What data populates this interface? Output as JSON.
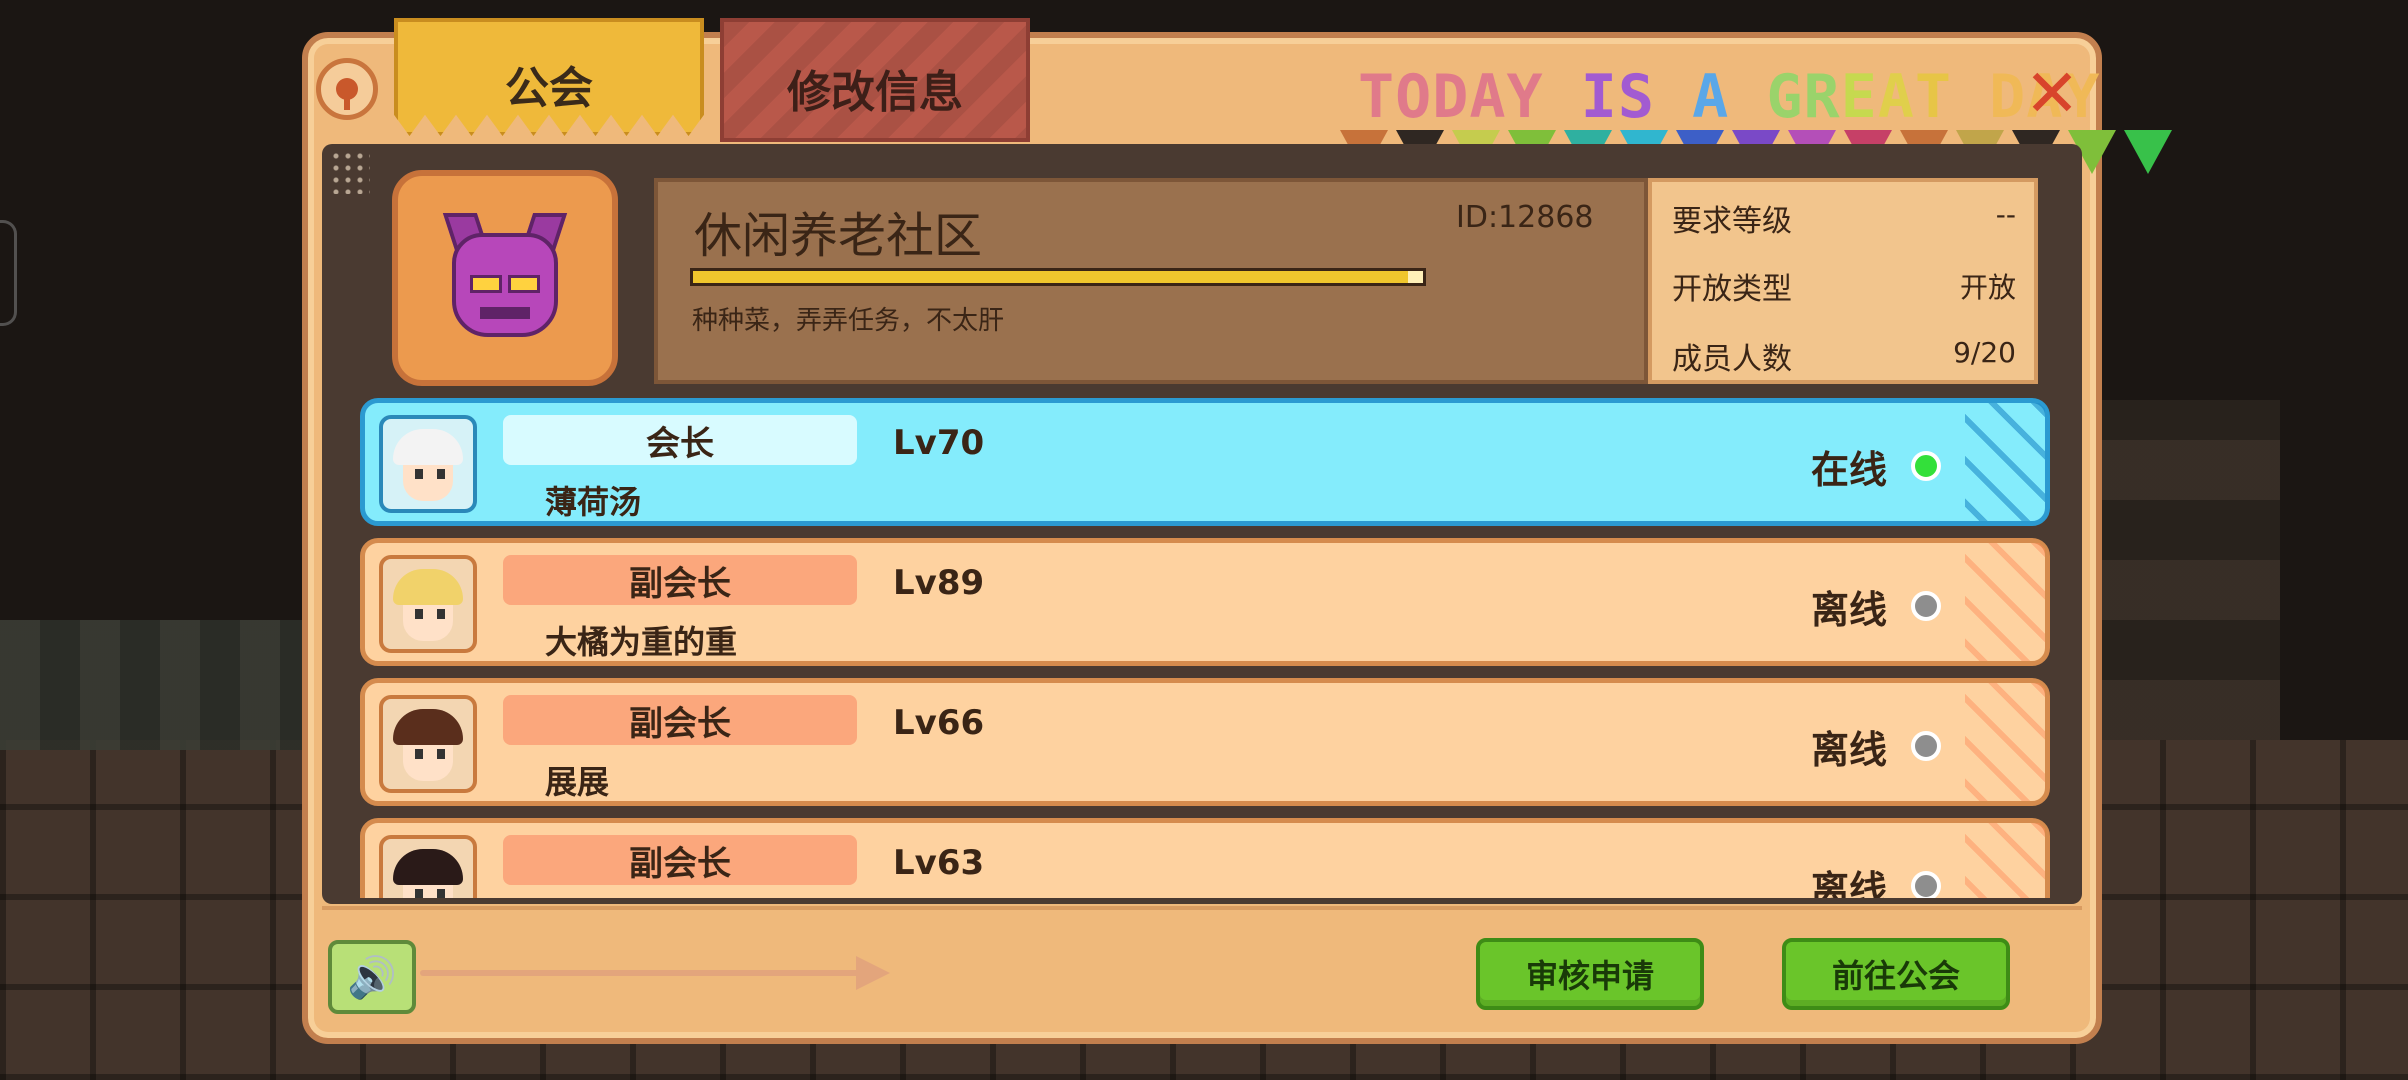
{
  "tabs": [
    {
      "label": "公会",
      "active": true
    },
    {
      "label": "修改信息",
      "active": false
    }
  ],
  "banner": {
    "letters": [
      {
        "c": "T",
        "color": "#e07a8a"
      },
      {
        "c": "O",
        "color": "#e07a8a"
      },
      {
        "c": "D",
        "color": "#e07a8a"
      },
      {
        "c": "A",
        "color": "#e07a8a"
      },
      {
        "c": "Y",
        "color": "#e07a8a"
      },
      {
        "c": " ",
        "color": "#000"
      },
      {
        "c": "I",
        "color": "#a25bd1"
      },
      {
        "c": "S",
        "color": "#a25bd1"
      },
      {
        "c": " ",
        "color": "#000"
      },
      {
        "c": "A",
        "color": "#5aa7e8"
      },
      {
        "c": " ",
        "color": "#000"
      },
      {
        "c": "G",
        "color": "#9ad36b"
      },
      {
        "c": "R",
        "color": "#9ad36b"
      },
      {
        "c": "E",
        "color": "#c6d94f"
      },
      {
        "c": "A",
        "color": "#e0cf4b"
      },
      {
        "c": "T",
        "color": "#e7c546"
      },
      {
        "c": " ",
        "color": "#000"
      },
      {
        "c": "D",
        "color": "#f0b957"
      },
      {
        "c": "A",
        "color": "#f0b957"
      },
      {
        "c": "Y",
        "color": "#f0b957"
      }
    ]
  },
  "flags": [
    "#c7723a",
    "#2f2722",
    "#c5cc4e",
    "#7fbf3a",
    "#2fb0a0",
    "#30b6cf",
    "#3d5fc7",
    "#7a49c7",
    "#b44fb8",
    "#c64067",
    "#c7723a",
    "#c1a54a",
    "#2f2722",
    "#7fbf3a",
    "#38c14a"
  ],
  "guild": {
    "name": "休闲养老社区",
    "id": "ID:12868",
    "progress": 0.98,
    "description": "种种菜，弄弄任务，不太肝",
    "stats": [
      {
        "label": "要求等级",
        "value": "--"
      },
      {
        "label": "开放类型",
        "value": "开放"
      },
      {
        "label": "成员人数",
        "value": "9/20"
      }
    ]
  },
  "members": [
    {
      "role": "会长",
      "name": "薄荷汤",
      "level": "Lv70",
      "status": "在线",
      "leader": true,
      "hair": "#f3f3f3",
      "avatar": "white-hood-avatar"
    },
    {
      "role": "副会长",
      "name": "大橘为重的重",
      "level": "Lv89",
      "status": "离线",
      "leader": false,
      "hair": "#f1d26a",
      "avatar": "blonde-avatar"
    },
    {
      "role": "副会长",
      "name": "展展",
      "level": "Lv66",
      "status": "离线",
      "leader": false,
      "hair": "#5a2e1c",
      "avatar": "brown-hair-avatar"
    },
    {
      "role": "副会长",
      "name": "",
      "level": "Lv63",
      "status": "离线",
      "leader": false,
      "hair": "#2a1a18",
      "avatar": "dark-hair-avatar"
    }
  ],
  "buttons": {
    "review": "审核申请",
    "goto_guild": "前往公会"
  },
  "icons": {
    "info": "info-icon",
    "close": "close-icon",
    "voice": "voice-icon"
  }
}
